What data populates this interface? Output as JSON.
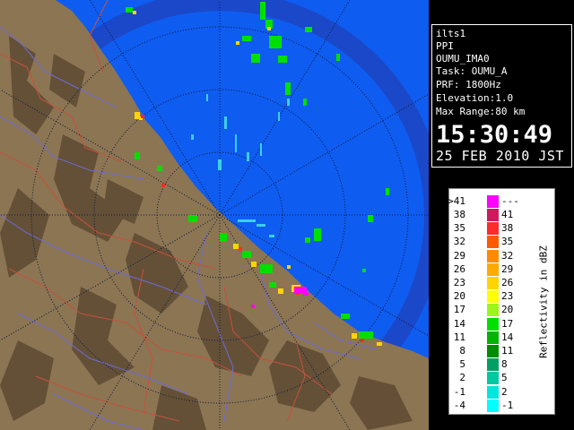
{
  "info": {
    "station": "ilts1",
    "mode": "PPI",
    "product": "OUMU_IMA0",
    "task": "Task: OUMU_A",
    "prf": "PRF: 1800Hz",
    "elevation": "Elevation:1.0",
    "max_range": "Max Range:80 km",
    "time": "15:30:49",
    "date": "25 FEB 2010 JST"
  },
  "legend": {
    "unit_label": "Reflectivity in dBZ",
    "top_lo": ">41",
    "top_hi": "---",
    "top_color": "#ff00ff",
    "rows": [
      {
        "lo": "38",
        "hi": "41",
        "color": "#cc1a5c"
      },
      {
        "lo": "35",
        "hi": "38",
        "color": "#ff2a2a"
      },
      {
        "lo": "32",
        "hi": "35",
        "color": "#ff5a00"
      },
      {
        "lo": "29",
        "hi": "32",
        "color": "#ff8c00"
      },
      {
        "lo": "26",
        "hi": "29",
        "color": "#ffaa00"
      },
      {
        "lo": "23",
        "hi": "26",
        "color": "#ffd400"
      },
      {
        "lo": "20",
        "hi": "23",
        "color": "#ffff00"
      },
      {
        "lo": "17",
        "hi": "20",
        "color": "#9cf51a"
      },
      {
        "lo": "14",
        "hi": "17",
        "color": "#00e000"
      },
      {
        "lo": "11",
        "hi": "14",
        "color": "#00b400"
      },
      {
        "lo": "8",
        "hi": "11",
        "color": "#008c00"
      },
      {
        "lo": "5",
        "hi": "8",
        "color": "#00a064"
      },
      {
        "lo": "2",
        "hi": "5",
        "color": "#00c8a0"
      },
      {
        "lo": "-1",
        "hi": "2",
        "color": "#00e6dc"
      },
      {
        "lo": "-4",
        "hi": "-1",
        "color": "#00ffff"
      }
    ]
  },
  "colors": {
    "sea": "#0f5cf0",
    "range_ring_outer": "#1b48c8",
    "land": "#8c7553",
    "land_dark": "#5b4731",
    "river": "#6b6bd8",
    "boundary": "#c8503c",
    "grid": "#0a1a3c"
  }
}
